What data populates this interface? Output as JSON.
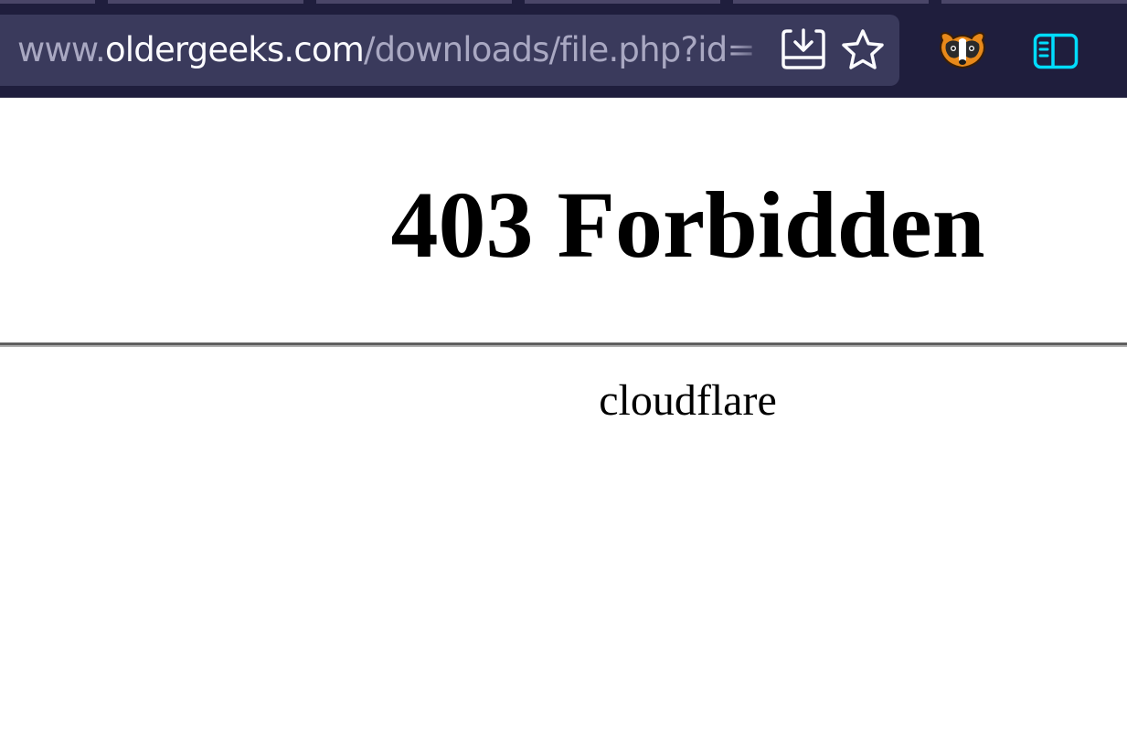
{
  "browser": {
    "url": {
      "prefix": "www.",
      "host": "oldergeeks.com",
      "path": "/downloads/file.php?id="
    },
    "icons": {
      "save_to_pocket": "download-tray-icon",
      "bookmark": "star-icon",
      "extension": "privacy-badger-icon",
      "sidebar": "sidebar-toggle-icon"
    },
    "colors": {
      "toolbar": "#1f1e3d",
      "urlbar": "#3a3a5c",
      "url_text_dim": "#a9a8c2",
      "url_text_host": "#fbfbfe",
      "sidebar_accent": "#00ddff"
    }
  },
  "page": {
    "heading": "403 Forbidden",
    "server": "cloudflare"
  }
}
